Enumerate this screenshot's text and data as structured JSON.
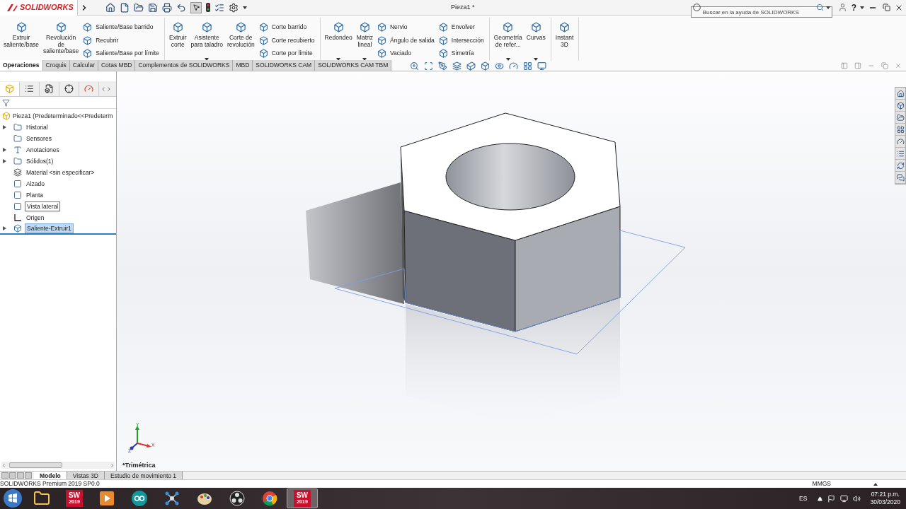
{
  "title_bar": {
    "logo": "SOLIDWORKS",
    "title": "Pieza1 *",
    "search": {
      "placeholder": "Buscar en la ayuda de SOLIDWORKS"
    },
    "help": "?"
  },
  "ribbon": {
    "groups": [
      {
        "columns": [
          {
            "kind": "large",
            "label": "Extruir\nsaliente/base",
            "dropdown": false
          },
          {
            "kind": "large",
            "label": "Revolución\nde\nsaliente/base",
            "dropdown": false
          },
          {
            "kind": "stack",
            "items": [
              "Saliente/Base barrido",
              "Recubrir",
              "Saliente/Base por límite"
            ]
          }
        ]
      },
      {
        "columns": [
          {
            "kind": "large",
            "label": "Extruir\ncorte",
            "dropdown": false
          },
          {
            "kind": "large",
            "label": "Asistente\npara taladro",
            "dropdown": true
          },
          {
            "kind": "large",
            "label": "Corte de\nrevolución",
            "dropdown": false
          },
          {
            "kind": "stack",
            "items": [
              "Corte barrido",
              "Corte recubierto",
              "Corte por límite"
            ]
          }
        ]
      },
      {
        "columns": [
          {
            "kind": "large",
            "label": "Redondeo",
            "dropdown": true
          },
          {
            "kind": "large",
            "label": "Matriz\nlineal",
            "dropdown": true
          },
          {
            "kind": "stack",
            "items": [
              "Nervio",
              "Ángulo de salida",
              "Vaciado"
            ]
          },
          {
            "kind": "stack",
            "items": [
              "Envolver",
              "Intersección",
              "Simetría"
            ]
          }
        ]
      },
      {
        "columns": [
          {
            "kind": "large",
            "label": "Geometría\nde refer...",
            "dropdown": true
          },
          {
            "kind": "large",
            "label": "Curvas",
            "dropdown": true
          }
        ]
      },
      {
        "columns": [
          {
            "kind": "large",
            "label": "Instant\n3D",
            "dropdown": false
          }
        ]
      }
    ]
  },
  "command_tabs": [
    {
      "label": "Operaciones",
      "selected": true
    },
    {
      "label": "Croquis",
      "selected": false
    },
    {
      "label": "Calcular",
      "selected": false
    },
    {
      "label": "Cotas MBD",
      "selected": false
    },
    {
      "label": "Complementos de SOLIDWORKS",
      "selected": false
    },
    {
      "label": "MBD",
      "selected": false
    },
    {
      "label": "SOLIDWORKS CAM",
      "selected": false
    },
    {
      "label": "SOLIDWORKS CAM TBM",
      "selected": false
    }
  ],
  "panel_tabs": [
    {
      "selected": true
    },
    {
      "selected": false
    },
    {
      "selected": false
    },
    {
      "selected": false
    },
    {
      "selected": false
    }
  ],
  "feature_tree": {
    "root": "Pieza1  (Predeterminado<<Predeterm",
    "items": [
      {
        "kind": "history",
        "label": "Historial",
        "expandable": true,
        "selected": false,
        "hovered": false
      },
      {
        "kind": "sensor",
        "label": "Sensores",
        "expandable": false,
        "selected": false,
        "hovered": false
      },
      {
        "kind": "annotation",
        "label": "Anotaciones",
        "expandable": true,
        "selected": false,
        "hovered": false
      },
      {
        "kind": "solid",
        "label": "Sólidos(1)",
        "expandable": true,
        "selected": false,
        "hovered": false
      },
      {
        "kind": "material",
        "label": "Material <sin especificar>",
        "expandable": false,
        "selected": false,
        "hovered": false
      },
      {
        "kind": "plane",
        "label": "Alzado",
        "expandable": false,
        "selected": false,
        "hovered": false
      },
      {
        "kind": "plane",
        "label": "Planta",
        "expandable": false,
        "selected": false,
        "hovered": false
      },
      {
        "kind": "plane",
        "label": "Vista lateral",
        "expandable": false,
        "selected": false,
        "hovered": true
      },
      {
        "kind": "origin",
        "label": "Origen",
        "expandable": false,
        "selected": false,
        "hovered": false
      },
      {
        "kind": "feature",
        "label": "Saliente-Extruir1",
        "expandable": true,
        "selected": true,
        "hovered": false
      }
    ]
  },
  "viewport": {
    "view_name": "*Trimétrica",
    "axes": [
      "Y",
      "X",
      "Z"
    ]
  },
  "bottom_tabs": [
    {
      "label": "Modelo",
      "selected": true
    },
    {
      "label": "Vistas 3D",
      "selected": false
    },
    {
      "label": "Estudio de movimiento 1",
      "selected": false
    }
  ],
  "status_bar": {
    "product": "SOLIDWORKS Premium 2019 SP0.0",
    "units": "MMGS"
  },
  "taskbar": {
    "apps": [
      {
        "kind": "explorer",
        "active": false
      },
      {
        "kind": "solidworks",
        "label": "SW",
        "version": "2019",
        "active": false
      },
      {
        "kind": "media",
        "active": false
      },
      {
        "kind": "arduino",
        "active": false
      },
      {
        "kind": "network",
        "active": false
      },
      {
        "kind": "paint",
        "active": false
      },
      {
        "kind": "obs",
        "active": false
      },
      {
        "kind": "chrome",
        "active": false
      },
      {
        "kind": "solidworks",
        "label": "SW",
        "version": "2019",
        "active": true
      }
    ],
    "language": "ES",
    "time": "07:21 p.m.",
    "date": "30/03/2020"
  }
}
